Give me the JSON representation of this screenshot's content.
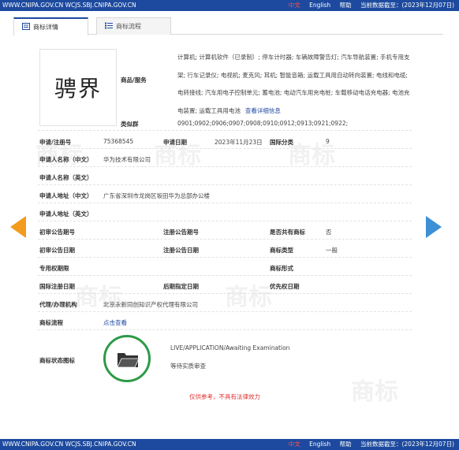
{
  "topbar": {
    "site": "WWW.CNIPA.GOV.CN WCJS.SBJ.CNIPA.GOV.CN",
    "lang_cn": "中文",
    "lang_en": "English",
    "help": "帮助",
    "data_date": "当前数据截至：(2023年12月07日)"
  },
  "tabs": [
    {
      "label": "商标详情",
      "icon": "document-icon"
    },
    {
      "label": "商标流程",
      "icon": "list-icon"
    }
  ],
  "trademark": {
    "mark_text": "骋界",
    "goods_label": "商品/服务",
    "goods_text": "计算机; 计算机软件（已录制）; 停车计时器; 车辆故障警告灯; 汽车导航装置; 手机专用支架; 行车记录仪; 电视机; 麦克风; 耳机; 智能音箱; 运载工具用自动转向装置; 电线和电缆; 电转接线; 汽车用电子控制单元; 蓄电池; 电动汽车用充电桩; 车载移动电话充电器; 电池充电装置; 运载工具用电池",
    "goods_more": "查看详细信息",
    "similar_group_label": "类似群",
    "similar_group_value": "0901;0902;0906;0907;0908;0910;0912;0913;0921;0922;"
  },
  "fields": {
    "reg_no_label": "申请/注册号",
    "reg_no_value": "75368545",
    "app_date_label": "申请日期",
    "app_date_value": "2023年11月23日",
    "intl_class_label": "国际分类",
    "intl_class_value": "9",
    "applicant_cn_label": "申请人名称（中文）",
    "applicant_cn_value": "华为技术有限公司",
    "applicant_en_label": "申请人名称（英文）",
    "address_cn_label": "申请人地址（中文）",
    "address_cn_value": "广东省深圳市龙岗区坂田华为总部办公楼",
    "address_en_label": "申请人地址（英文）",
    "prelim_no_label": "初审公告期号",
    "reg_pub_no_label": "注册公告期号",
    "shared_label": "是否共有商标",
    "shared_value": "否",
    "prelim_date_label": "初审公告日期",
    "reg_pub_date_label": "注册公告日期",
    "tm_type_label": "商标类型",
    "tm_type_value": "一般",
    "exclusive_label": "专用权期限",
    "tm_form_label": "商标形式",
    "intl_reg_date_label": "国际注册日期",
    "later_date_label": "后期指定日期",
    "priority_date_label": "优先权日期",
    "agent_label": "代理/办理机构",
    "agent_value": "北京永新同创知识产权代理有限公司",
    "process_label": "商标流程",
    "process_link": "点击查看",
    "status_label": "商标状态图标",
    "status_en": "LIVE/APPLICATION/Awaiting Examination",
    "status_cn": "等待实质审查"
  },
  "disclaimer": "仅供参考，不具有法律效力",
  "watermark": "商标",
  "colors": {
    "brand_blue": "#1d4a9e",
    "prev_arrow": "#f29b1d",
    "next_arrow": "#3d8fd6",
    "status_green": "#2d9a48",
    "warning_red": "#e03131"
  }
}
